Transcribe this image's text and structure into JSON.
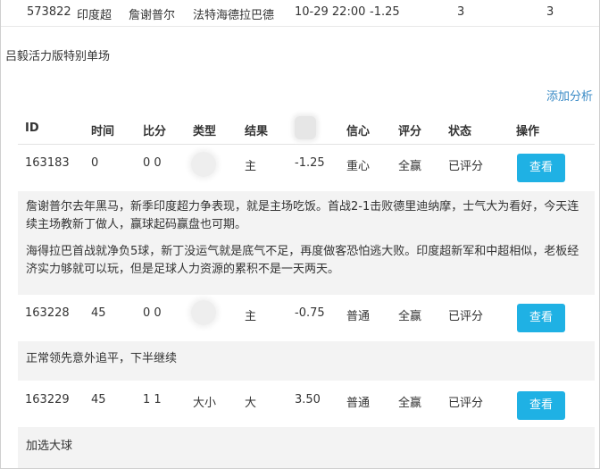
{
  "top_row": {
    "id": "573822",
    "league": "印度超",
    "home": "詹谢普尔",
    "away": "法特海德拉巴德",
    "time": "10-29 22:00",
    "handicap": "-1.25",
    "val1": "3",
    "val2": "3"
  },
  "section_title": "吕毅活力版特别单场",
  "add_analysis": "添加分析",
  "table": {
    "headers": {
      "id": "ID",
      "time": "时间",
      "score": "比分",
      "type": "类型",
      "result": "结果",
      "confidence": "信心",
      "rating": "评分",
      "status": "状态",
      "action": "操作"
    },
    "rows": [
      {
        "id": "163183",
        "time": "0",
        "score": "0 0",
        "type": "",
        "result": "主",
        "line": "-1.25",
        "confidence": "重心",
        "rating": "全赢",
        "status": "已评分",
        "button": "查看",
        "comments": [
          "詹谢普尔去年黑马，新季印度超力争表现，就是主场吃饭。首战2-1击败德里迪纳摩，士气大为看好，今天连续主场教新丁做人，赢球起码赢盘也可期。",
          "海得拉巴首战就净负5球，新丁没运气就是底气不足，再度做客恐怕逃大败。印度超新军和中超相似，老板经济实力够就可以玩，但是足球人力资源的累积不是一天两天。"
        ]
      },
      {
        "id": "163228",
        "time": "45",
        "score": "0 0",
        "type": "",
        "result": "主",
        "line": "-0.75",
        "confidence": "普通",
        "rating": "全赢",
        "status": "已评分",
        "button": "查看",
        "comments": [
          "正常领先意外追平，下半继续"
        ]
      },
      {
        "id": "163229",
        "time": "45",
        "score": "1 1",
        "type": "大小",
        "result": "大",
        "line": "3.50",
        "confidence": "普通",
        "rating": "全赢",
        "status": "已评分",
        "button": "查看",
        "comments": [
          "加选大球"
        ]
      }
    ]
  }
}
